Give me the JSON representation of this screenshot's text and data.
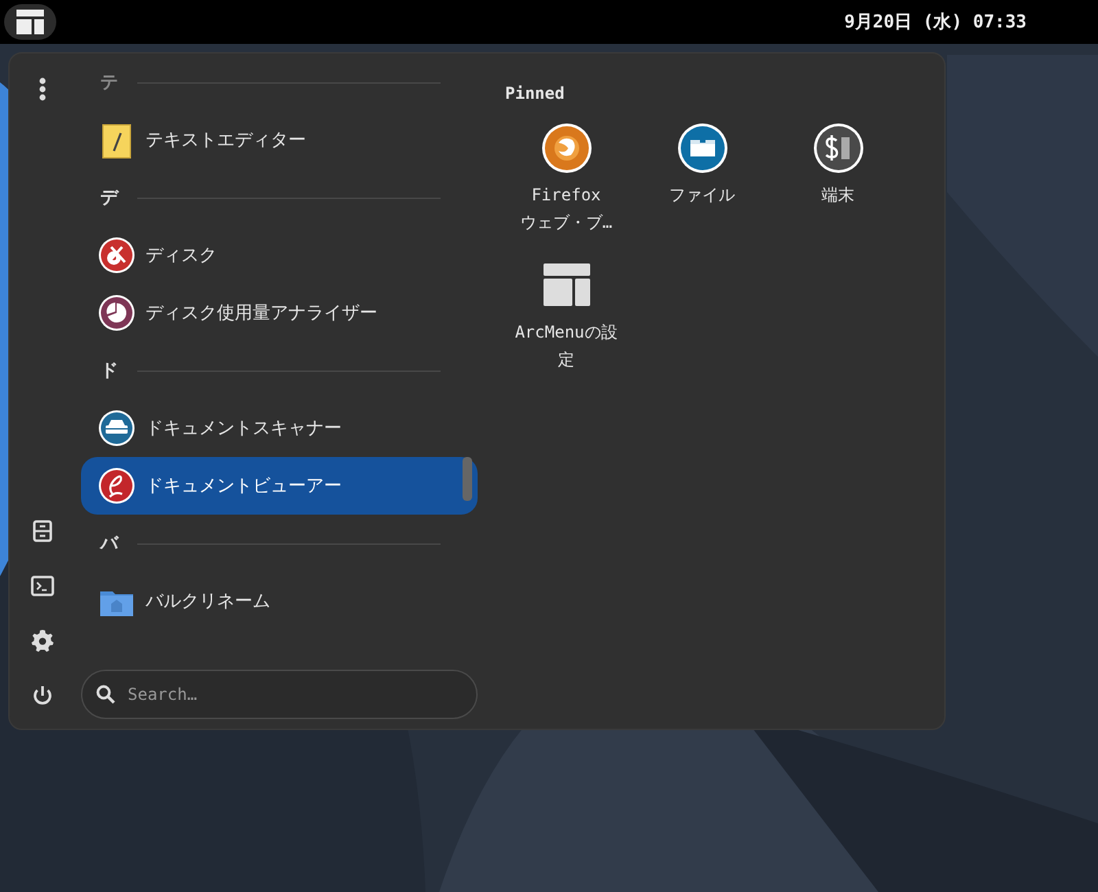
{
  "top_bar": {
    "clock": "9月20日 (水) 07:33"
  },
  "side_rail": {
    "actions": [
      {
        "kind": "cabinet"
      },
      {
        "kind": "terminal"
      },
      {
        "kind": "gear"
      },
      {
        "kind": "power"
      }
    ]
  },
  "app_list": {
    "sections": [
      {
        "header": "テ",
        "faded": true,
        "items": [
          {
            "label": "テキストエディター",
            "kind": "editor",
            "selected": false
          }
        ]
      },
      {
        "header": "デ",
        "faded": false,
        "items": [
          {
            "label": "ディスク",
            "kind": "disk",
            "selected": false
          },
          {
            "label": "ディスク使用量アナライザー",
            "kind": "analyzer",
            "selected": false
          }
        ]
      },
      {
        "header": "ド",
        "faded": false,
        "items": [
          {
            "label": "ドキュメントスキャナー",
            "kind": "scanner",
            "selected": false
          },
          {
            "label": "ドキュメントビューアー",
            "kind": "viewer",
            "selected": true
          }
        ]
      },
      {
        "header": "バ",
        "faded": false,
        "items": [
          {
            "label": "バルクリネーム",
            "kind": "folder",
            "selected": false
          }
        ]
      }
    ]
  },
  "search": {
    "placeholder": "Search…"
  },
  "pinned": {
    "title": "Pinned",
    "items": [
      {
        "lines": [
          "Firefox",
          "ウェブ・ブ…"
        ],
        "kind": "firefox"
      },
      {
        "lines": [
          "ファイル"
        ],
        "kind": "files"
      },
      {
        "lines": [
          "端末"
        ],
        "kind": "terminal"
      },
      {
        "lines": [
          "ArcMenuの設",
          "定"
        ],
        "kind": "layout"
      }
    ]
  }
}
